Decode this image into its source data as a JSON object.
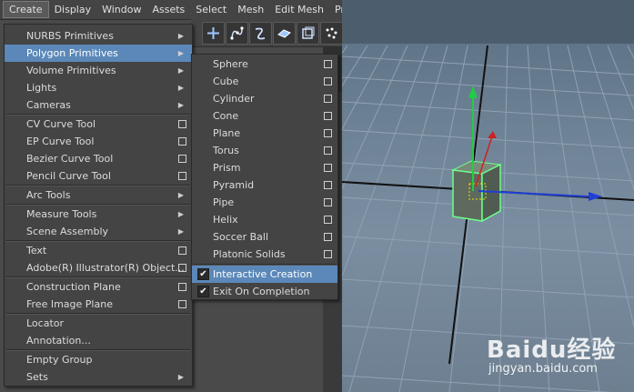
{
  "menubar": {
    "items": [
      {
        "label": "Create"
      },
      {
        "label": "Display"
      },
      {
        "label": "Window"
      },
      {
        "label": "Assets"
      },
      {
        "label": "Select"
      },
      {
        "label": "Mesh"
      },
      {
        "label": "Edit Mesh"
      },
      {
        "label": "Proxy"
      }
    ]
  },
  "create_menu": {
    "items": [
      {
        "label": "NURBS Primitives",
        "kind": "submenu"
      },
      {
        "label": "Polygon Primitives",
        "kind": "submenu",
        "highlighted": true
      },
      {
        "label": "Volume Primitives",
        "kind": "submenu"
      },
      {
        "label": "Lights",
        "kind": "submenu"
      },
      {
        "label": "Cameras",
        "kind": "submenu"
      },
      {
        "label": "CV Curve Tool",
        "kind": "option"
      },
      {
        "label": "EP Curve Tool",
        "kind": "option"
      },
      {
        "label": "Bezier Curve Tool",
        "kind": "option"
      },
      {
        "label": "Pencil Curve Tool",
        "kind": "option"
      },
      {
        "label": "Arc Tools",
        "kind": "submenu"
      },
      {
        "label": "Measure Tools",
        "kind": "submenu"
      },
      {
        "label": "Scene Assembly",
        "kind": "submenu"
      },
      {
        "label": "Text",
        "kind": "option"
      },
      {
        "label": "Adobe(R) Illustrator(R) Object...",
        "kind": "option"
      },
      {
        "label": "Construction Plane",
        "kind": "option"
      },
      {
        "label": "Free Image Plane",
        "kind": "option"
      },
      {
        "label": "Locator",
        "kind": "plain"
      },
      {
        "label": "Annotation...",
        "kind": "plain"
      },
      {
        "label": "Empty Group",
        "kind": "plain"
      },
      {
        "label": "Sets",
        "kind": "submenu"
      }
    ]
  },
  "poly_menu": {
    "items": [
      {
        "label": "Sphere"
      },
      {
        "label": "Cube"
      },
      {
        "label": "Cylinder"
      },
      {
        "label": "Cone"
      },
      {
        "label": "Plane"
      },
      {
        "label": "Torus"
      },
      {
        "label": "Prism"
      },
      {
        "label": "Pyramid"
      },
      {
        "label": "Pipe"
      },
      {
        "label": "Helix"
      },
      {
        "label": "Soccer Ball"
      },
      {
        "label": "Platonic Solids"
      }
    ],
    "checks": [
      {
        "label": "Interactive Creation",
        "checked": true,
        "highlighted": true
      },
      {
        "label": "Exit On Completion",
        "checked": true
      }
    ]
  },
  "icons": {
    "submenu": "triangle-right-icon",
    "option_box": "option-box-icon",
    "check": "checkmark-icon"
  },
  "colors": {
    "highlight": "#5b88b8",
    "menu_bg": "#444444",
    "cube_wire": "#6cff8a",
    "axis_y": "#22cc44",
    "axis_z": "#1f3fd6",
    "axis_x": "#cc2222"
  },
  "watermark": {
    "logo": "Baidu经验",
    "url": "jingyan.baidu.com"
  }
}
